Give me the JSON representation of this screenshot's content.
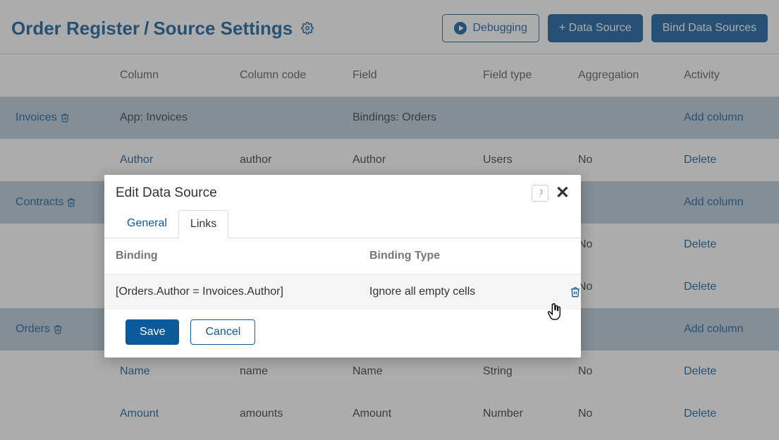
{
  "breadcrumb": {
    "parent": "Order Register",
    "sep": "/",
    "current": "Source Settings"
  },
  "header_buttons": {
    "debugging": "Debugging",
    "add_source": "+ Data Source",
    "bind_sources": "Bind Data Sources"
  },
  "columns": {
    "col1": "Column",
    "col2": "Column code",
    "col3": "Field",
    "col4": "Field type",
    "col5": "Aggregation",
    "col6": "Activity"
  },
  "sections": [
    {
      "name": "Invoices",
      "app_label": "App: Invoices",
      "bindings_label": "Bindings: Orders",
      "add_col": "Add column",
      "rows": [
        {
          "col": "Author",
          "code": "author",
          "field": "Author",
          "ftype": "Users",
          "agg": "No",
          "act": "Delete"
        }
      ]
    },
    {
      "name": "Contracts",
      "app_label": "",
      "bindings_label": "",
      "add_col": "Add column",
      "rows": [
        {
          "col": "",
          "code": "",
          "field": "",
          "ftype": "",
          "agg": "No",
          "act": "Delete"
        },
        {
          "col": "",
          "code": "",
          "field": "",
          "ftype": "",
          "agg": "No",
          "act": "Delete"
        }
      ]
    },
    {
      "name": "Orders",
      "app_label": "",
      "bindings_label": "",
      "add_col": "Add column",
      "rows": [
        {
          "col": "Name",
          "code": "name",
          "field": "Name",
          "ftype": "String",
          "agg": "No",
          "act": "Delete"
        },
        {
          "col": "Amount",
          "code": "amounts",
          "field": "Amount",
          "ftype": "Number",
          "agg": "No",
          "act": "Delete"
        }
      ]
    }
  ],
  "modal": {
    "title": "Edit Data Source",
    "tabs": {
      "general": "General",
      "links": "Links"
    },
    "head": {
      "binding": "Binding",
      "btype": "Binding Type"
    },
    "row": {
      "binding": "[Orders.Author = Invoices.Author]",
      "btype": "Ignore all empty cells"
    },
    "save": "Save",
    "cancel": "Cancel"
  }
}
